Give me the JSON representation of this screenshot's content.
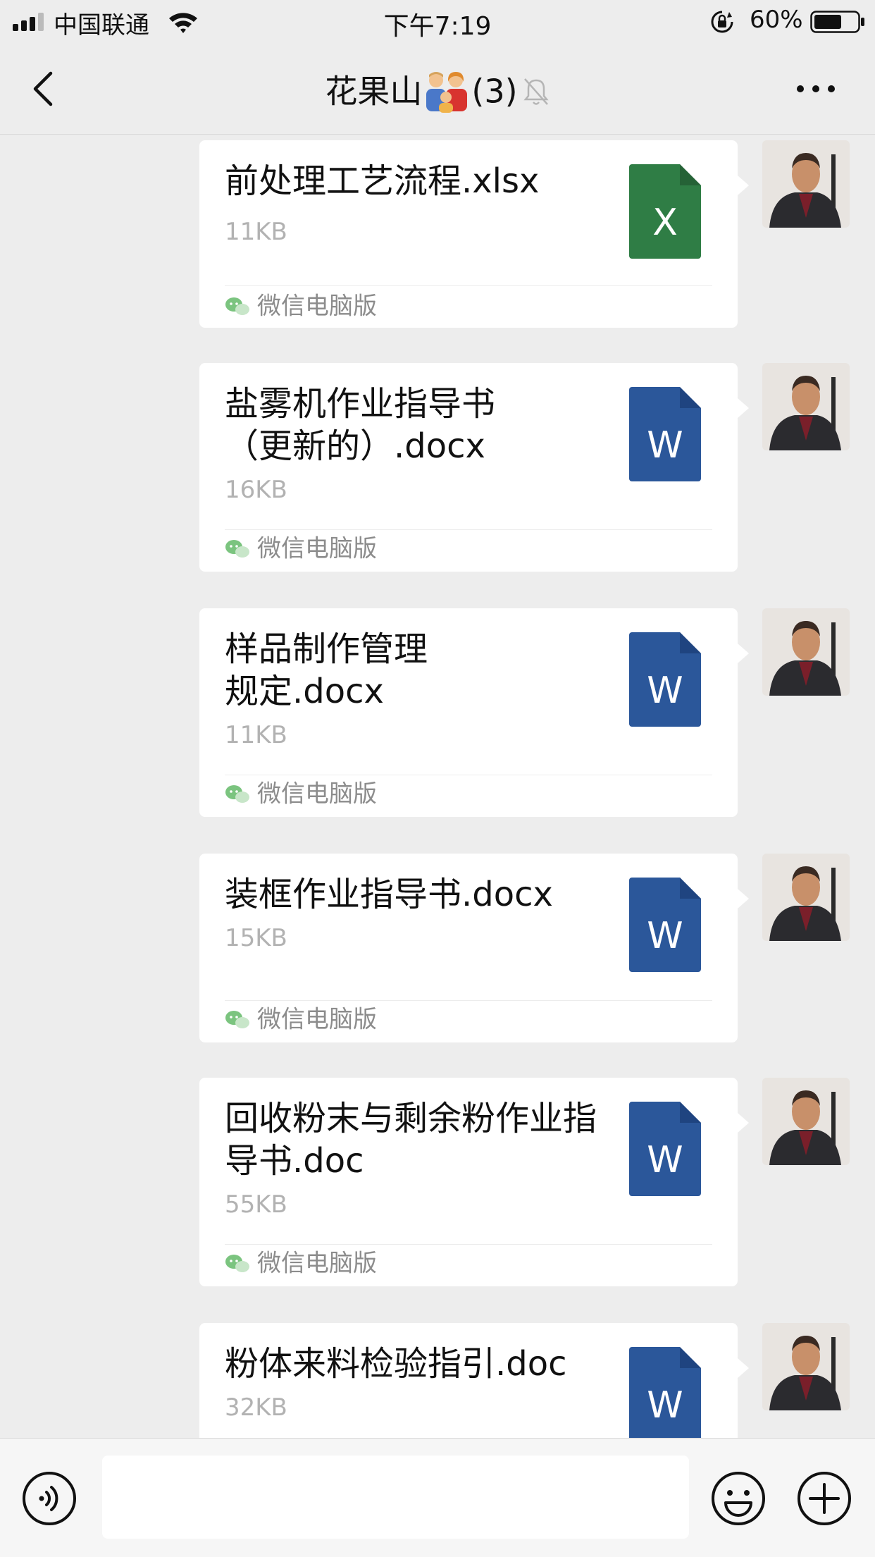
{
  "status_bar": {
    "carrier": "中国联通",
    "time": "下午7:19",
    "battery": "60%"
  },
  "nav": {
    "title": "花果山",
    "title_emoji": "family-icon",
    "member_count": "(3)",
    "icons": {
      "back": "chevron-left-icon",
      "mute": "bell-off-icon",
      "more": "more-dots-icon"
    }
  },
  "colors": {
    "background": "#ededed",
    "bubble": "#ffffff",
    "excel_green": "#2f7d45",
    "word_blue": "#2b579a",
    "size_grey": "#b2b2b2",
    "wechat_green": "#7bc47f"
  },
  "messages": [
    {
      "name": "前处理工艺流程.xlsx",
      "size": "11KB",
      "type": "X",
      "source": "微信电脑版"
    },
    {
      "name": "盐雾机作业指导书（更新的）.docx",
      "size": "16KB",
      "type": "W",
      "source": "微信电脑版"
    },
    {
      "name": "样品制作管理规定.docx",
      "size": "11KB",
      "type": "W",
      "source": "微信电脑版"
    },
    {
      "name": "装框作业指导书.docx",
      "size": "15KB",
      "type": "W",
      "source": "微信电脑版"
    },
    {
      "name": "回收粉末与剩余粉作业指导书.doc",
      "size": "55KB",
      "type": "W",
      "source": "微信电脑版"
    },
    {
      "name": "粉体来料检验指引.doc",
      "size": "32KB",
      "type": "W",
      "source": ""
    }
  ],
  "input_bar": {
    "placeholder": "",
    "icons": {
      "voice": "voice-icon",
      "emoji": "emoji-icon",
      "plus": "plus-icon"
    }
  }
}
